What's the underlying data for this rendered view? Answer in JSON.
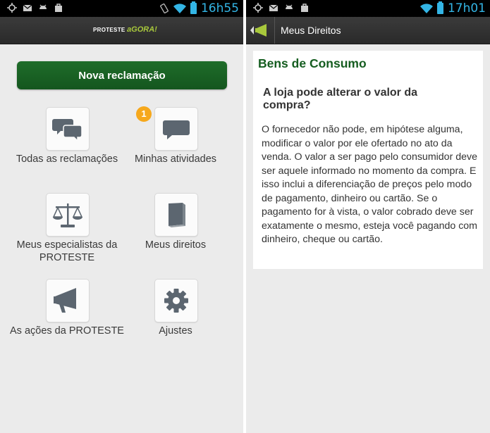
{
  "left_screen": {
    "status_bar": {
      "time": "16h55"
    },
    "header": {
      "logo_main": "PROTESTE",
      "logo_accent": "aGORA!"
    },
    "primary_button": "Nova reclamação",
    "tiles": [
      {
        "label": "Todas as reclamações",
        "icon": "chat-bubbles-icon"
      },
      {
        "label": "Minhas atividades",
        "icon": "chat-bubble-icon",
        "badge": "1"
      },
      {
        "label": "Meus especialistas da PROTESTE",
        "icon": "scales-icon"
      },
      {
        "label": "Meus direitos",
        "icon": "book-icon"
      },
      {
        "label": "As ações da PROTESTE",
        "icon": "megaphone-icon"
      },
      {
        "label": "Ajustes",
        "icon": "gear-icon"
      }
    ]
  },
  "right_screen": {
    "status_bar": {
      "time": "17h01"
    },
    "header": {
      "title": "Meus Direitos"
    },
    "article": {
      "category": "Bens de Consumo",
      "question": "A loja pode alterar o valor da compra?",
      "answer": "O fornecedor não pode, em hipótese alguma, modificar o valor por ele ofertado no ato da venda. O valor a ser pago pelo consumidor deve ser aquele informado no momento da compra. E isso inclui a diferenciação de preços pelo modo de pagamento, dinheiro ou cartão. Se o pagamento for à vista, o valor cobrado deve ser exatamente o mesmo, esteja você pagando com dinheiro, cheque ou cartão."
    }
  },
  "colors": {
    "brand_green": "#14561e",
    "badge_orange": "#f6a81c",
    "status_blue": "#33b5e5",
    "icon_gray": "#5c6670"
  }
}
